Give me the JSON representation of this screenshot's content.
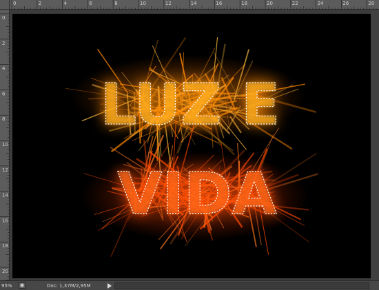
{
  "rulers": {
    "horizontal_ticks": [
      "0",
      "2",
      "4",
      "6",
      "8",
      "10",
      "12",
      "14",
      "16",
      "18",
      "20",
      "22",
      "24",
      "26",
      "28"
    ],
    "vertical_ticks": [
      "0",
      "2",
      "4",
      "6",
      "8",
      "10",
      "12",
      "14",
      "16",
      "18",
      "20"
    ]
  },
  "document": {
    "line1": "LUZ E",
    "line2": "VIDA",
    "colors": {
      "line1_fill": "#ffb020",
      "line1_glow": "#ff8a00",
      "line2_fill": "#ff6a18",
      "line2_glow": "#ff4a00",
      "selection": "#ffffff"
    }
  },
  "status": {
    "zoom": "95%",
    "doc_info": "Doc: 1,37M/2,95M",
    "icon": "document-status-icon",
    "arrow_icon": "menu-arrow-icon"
  }
}
